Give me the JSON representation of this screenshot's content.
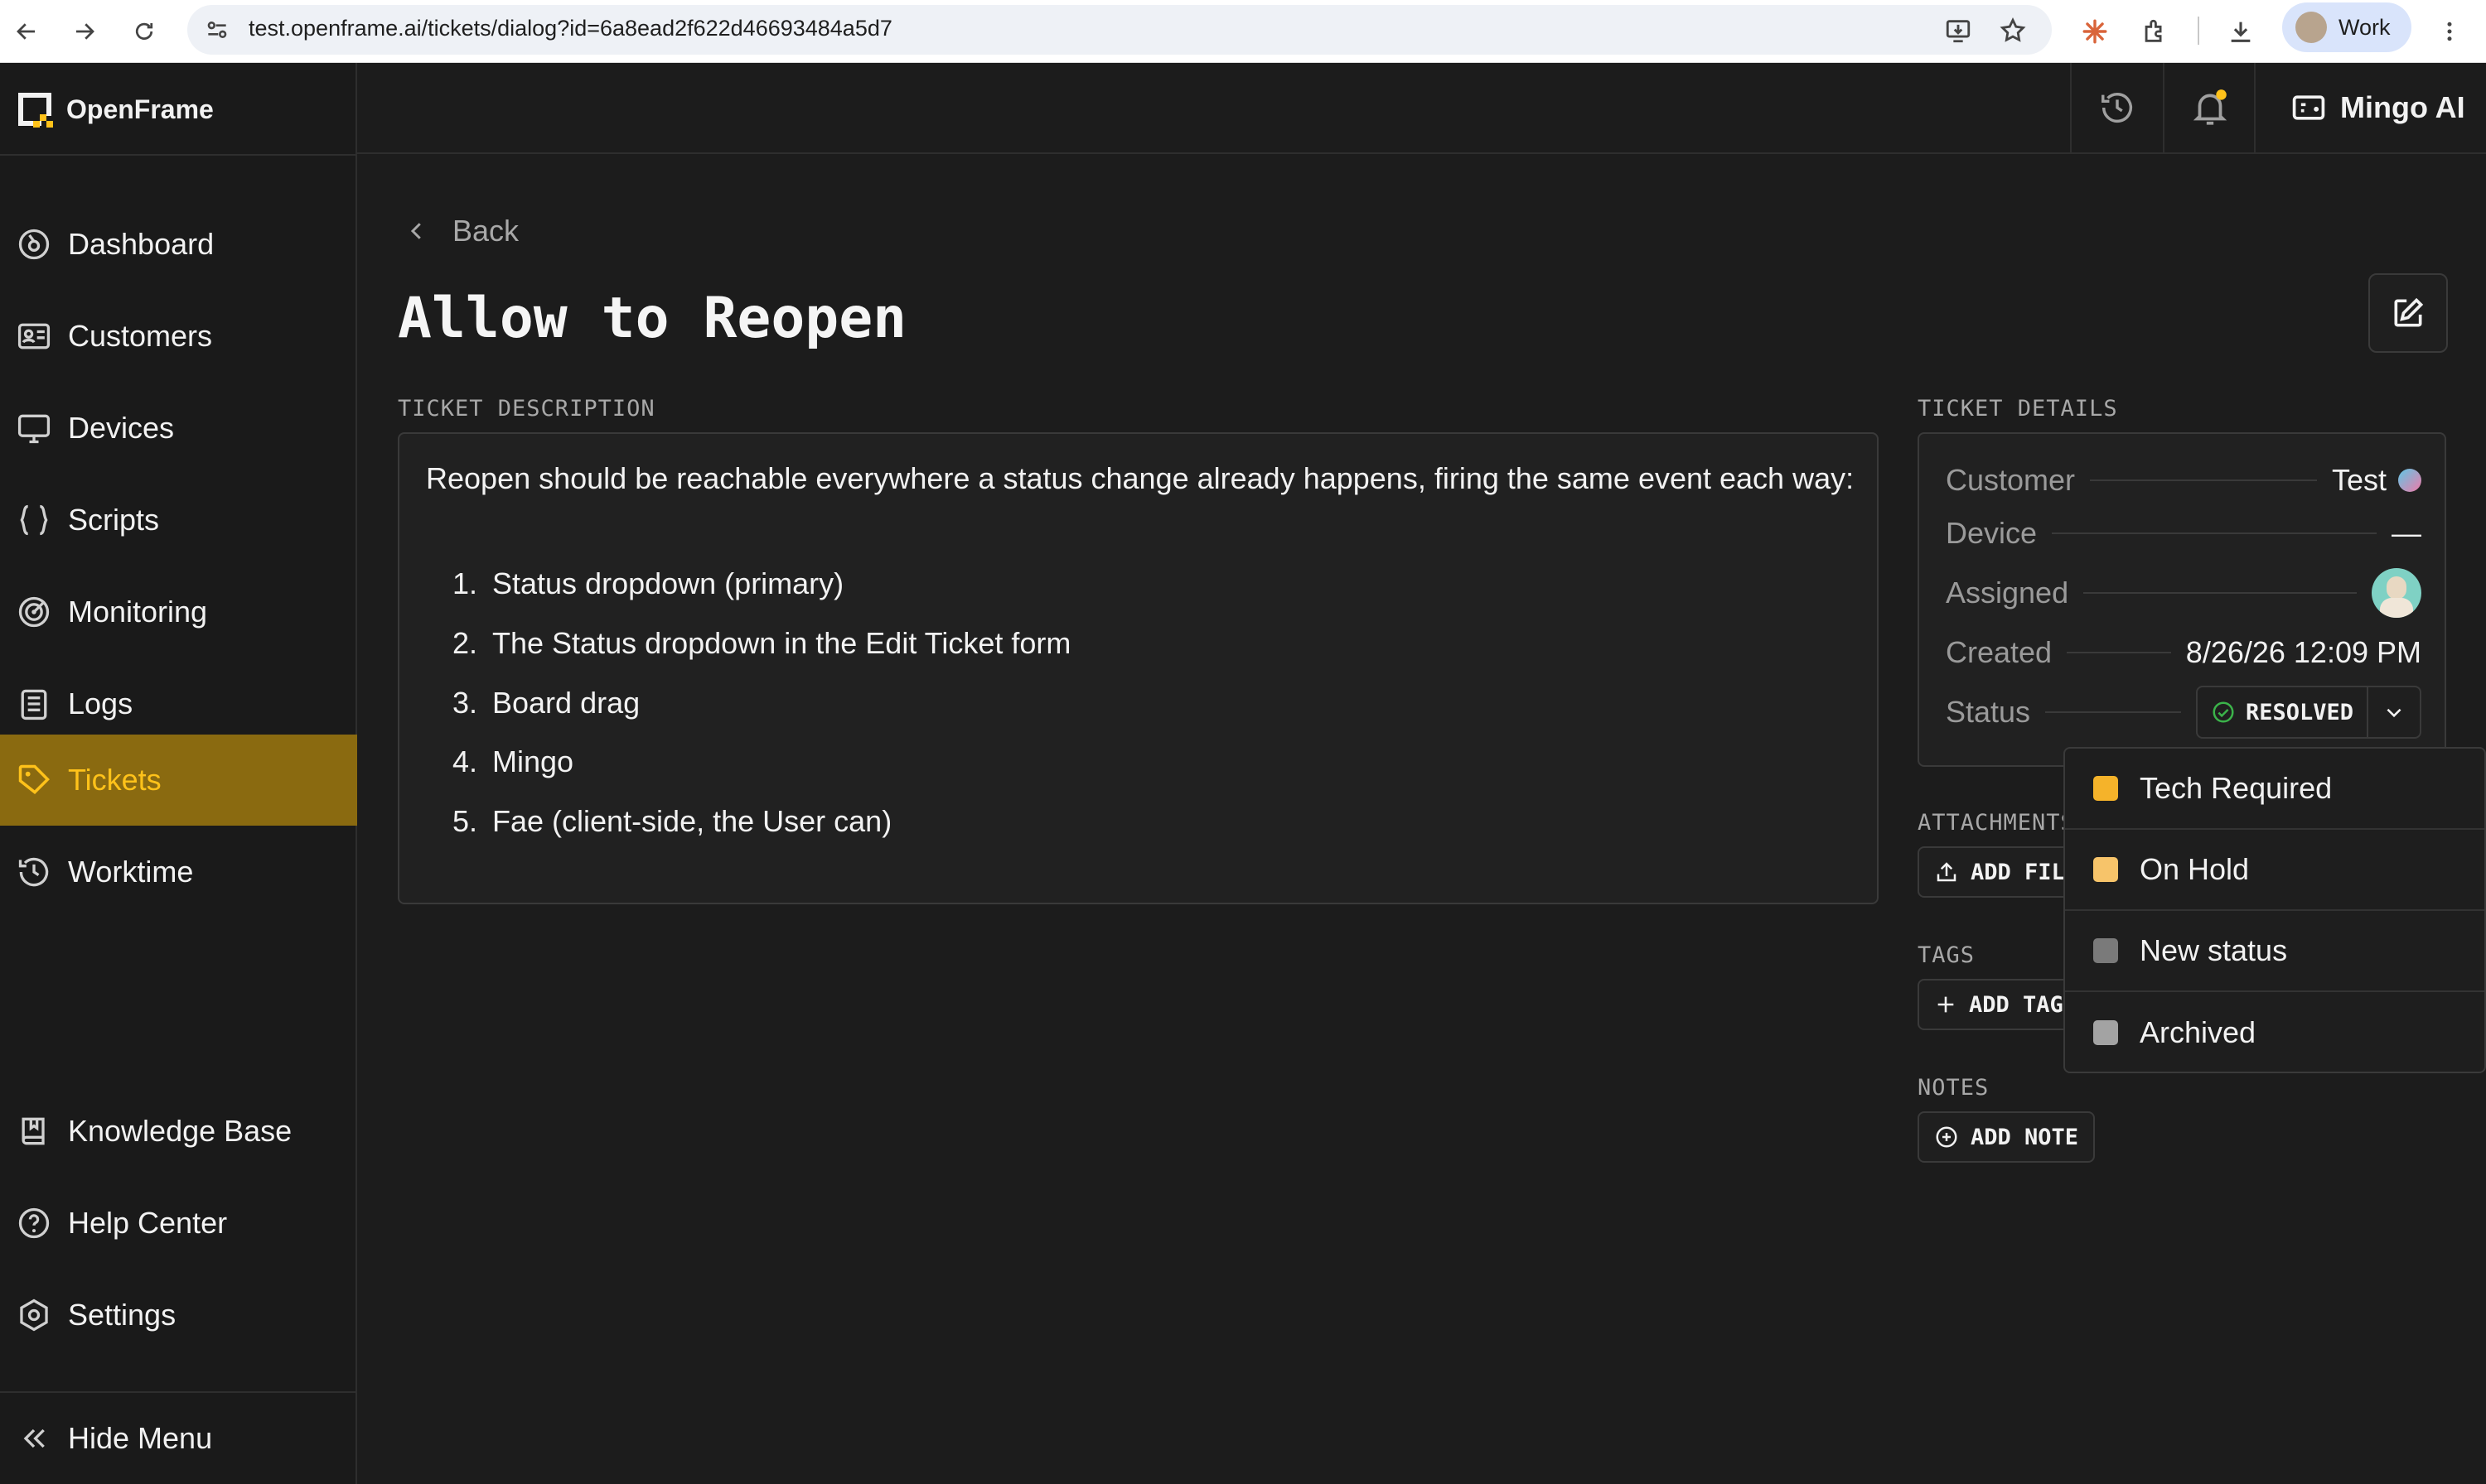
{
  "browser": {
    "url": "test.openframe.ai/tickets/dialog?id=6a8ead2f622d46693484a5d7",
    "profile_label": "Work"
  },
  "app": {
    "name": "OpenFrame",
    "assistant_label": "Mingo AI"
  },
  "sidebar": {
    "items": [
      {
        "label": "Dashboard",
        "icon": "dashboard-icon"
      },
      {
        "label": "Customers",
        "icon": "customers-icon"
      },
      {
        "label": "Devices",
        "icon": "devices-icon"
      },
      {
        "label": "Scripts",
        "icon": "scripts-icon"
      },
      {
        "label": "Monitoring",
        "icon": "monitoring-icon"
      },
      {
        "label": "Logs",
        "icon": "logs-icon"
      },
      {
        "label": "Tickets",
        "icon": "tickets-icon",
        "active": true
      },
      {
        "label": "Worktime",
        "icon": "worktime-icon"
      }
    ],
    "bottom_items": [
      {
        "label": "Knowledge Base",
        "icon": "knowledge-base-icon"
      },
      {
        "label": "Help Center",
        "icon": "help-icon"
      },
      {
        "label": "Settings",
        "icon": "settings-icon"
      }
    ],
    "hide_menu_label": "Hide Menu"
  },
  "page": {
    "back_label": "Back",
    "title": "Allow to Reopen",
    "description_label": "TICKET DESCRIPTION",
    "description_text": "Reopen should be reachable everywhere a status change already happens, firing the same event each way:",
    "description_list": [
      "Status dropdown (primary)",
      "The Status dropdown in the Edit Ticket form",
      "Board drag",
      "Mingo",
      "Fae (client-side, the User can)"
    ]
  },
  "details": {
    "label": "TICKET DETAILS",
    "customer_key": "Customer",
    "customer_value": "Test",
    "device_key": "Device",
    "device_value": "—",
    "assigned_key": "Assigned",
    "created_key": "Created",
    "created_value": "8/26/26 12:09 PM",
    "status_key": "Status",
    "status_value": "RESOLVED"
  },
  "attachments": {
    "label": "ATTACHMENTS",
    "button": "ADD FILE"
  },
  "tags": {
    "label": "TAGS",
    "button": "ADD TAG"
  },
  "notes": {
    "label": "NOTES",
    "button": "ADD NOTE"
  },
  "status_dropdown": {
    "options": [
      {
        "label": "Tech Required",
        "color": "#f5b32a"
      },
      {
        "label": "On Hold",
        "color": "#f7c46a"
      },
      {
        "label": "New status",
        "color": "#7a7a7a"
      },
      {
        "label": "Archived",
        "color": "#a3a3a3"
      }
    ]
  },
  "colors": {
    "accent": "#ffc21a",
    "active_nav_bg": "#8a6a10",
    "status_check": "#3bb34a"
  }
}
